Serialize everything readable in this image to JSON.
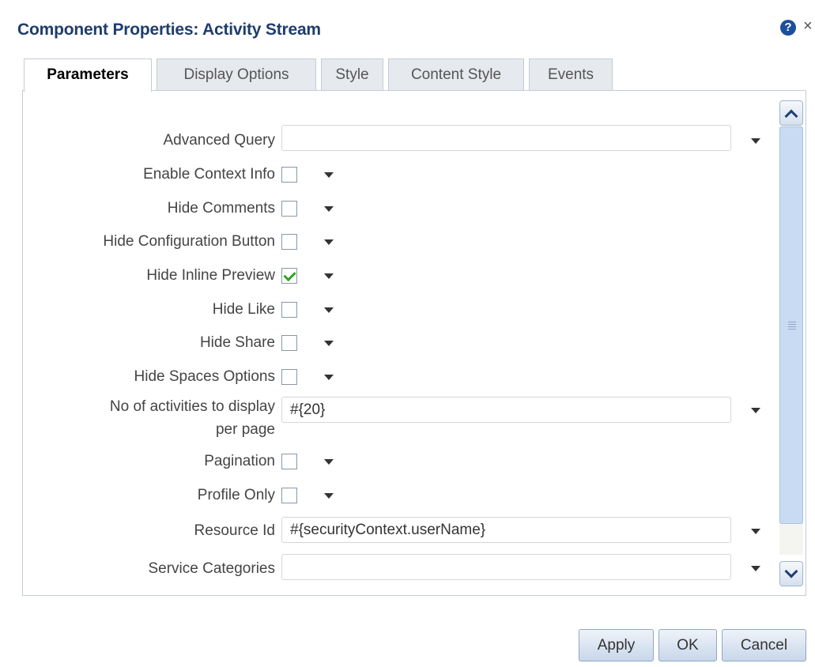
{
  "dialog": {
    "title": "Component Properties: Activity Stream"
  },
  "tabs": [
    {
      "label": "Parameters",
      "active": true
    },
    {
      "label": "Display Options",
      "active": false
    },
    {
      "label": "Style",
      "active": false
    },
    {
      "label": "Content Style",
      "active": false
    },
    {
      "label": "Events",
      "active": false
    }
  ],
  "fields": {
    "advanced_query": {
      "label": "Advanced Query",
      "value": ""
    },
    "enable_context_info": {
      "label": "Enable Context Info",
      "checked": false
    },
    "hide_comments": {
      "label": "Hide Comments",
      "checked": false
    },
    "hide_configuration_button": {
      "label": "Hide Configuration Button",
      "checked": false
    },
    "hide_inline_preview": {
      "label": "Hide Inline Preview",
      "checked": true
    },
    "hide_like": {
      "label": "Hide Like",
      "checked": false
    },
    "hide_share": {
      "label": "Hide Share",
      "checked": false
    },
    "hide_spaces_options": {
      "label": "Hide Spaces Options",
      "checked": false
    },
    "activities_per_page": {
      "label_line1": "No of activities to display",
      "label_line2": "per page",
      "value": "#{20}"
    },
    "pagination": {
      "label": "Pagination",
      "checked": false
    },
    "profile_only": {
      "label": "Profile Only",
      "checked": false
    },
    "resource_id": {
      "label": "Resource Id",
      "value": "#{securityContext.userName}"
    },
    "service_categories": {
      "label": "Service Categories",
      "value": ""
    }
  },
  "footer": {
    "apply_label": "Apply",
    "ok_label": "OK",
    "cancel_label": "Cancel"
  },
  "icons": {
    "help": "help-icon",
    "close": "close-icon",
    "dropdown": "triangle-down-icon"
  },
  "colors": {
    "title": "#1f3d6b",
    "check": "#2ba81e",
    "scroll_thumb": "#c9daf3"
  }
}
